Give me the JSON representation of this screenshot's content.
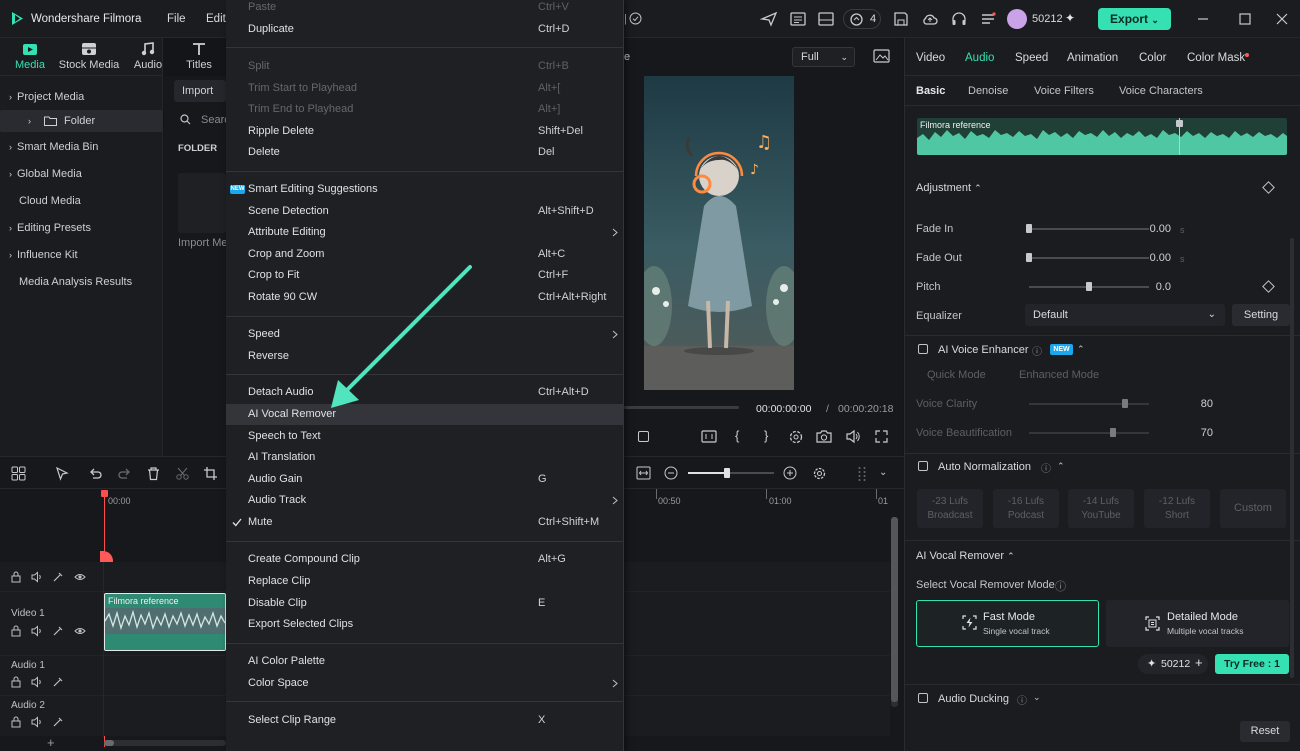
{
  "app": {
    "title": "Wondershare Filmora",
    "menu": [
      "File",
      "Edit"
    ],
    "credits": "50212",
    "undo_count": "4",
    "export_label": "Export"
  },
  "media_tabs": [
    "Media",
    "Stock Media",
    "Audio",
    "Titles"
  ],
  "left_tree": {
    "project_media": "Project Media",
    "folder": "Folder",
    "items": [
      "Smart Media Bin",
      "Global Media",
      "Cloud Media",
      "Editing Presets",
      "Influence Kit",
      "Media Analysis Results"
    ]
  },
  "media_area": {
    "import_label": "Import",
    "search_placeholder": "Search",
    "folder_header": "FOLDER",
    "import_media": "Import Media"
  },
  "context_menu": [
    {
      "label": "Paste",
      "shortcut": "Ctrl+V",
      "disabled": true
    },
    {
      "label": "Duplicate",
      "shortcut": "Ctrl+D"
    },
    {
      "label": "Split",
      "shortcut": "Ctrl+B",
      "disabled": true
    },
    {
      "label": "Trim Start to Playhead",
      "shortcut": "Alt+[",
      "disabled": true
    },
    {
      "label": "Trim End to Playhead",
      "shortcut": "Alt+]",
      "disabled": true
    },
    {
      "label": "Ripple Delete",
      "shortcut": "Shift+Del"
    },
    {
      "label": "Delete",
      "shortcut": "Del"
    },
    {
      "label": "Smart Editing Suggestions",
      "badge": "NEW"
    },
    {
      "label": "Scene Detection",
      "shortcut": "Alt+Shift+D"
    },
    {
      "label": "Attribute Editing",
      "submenu": true
    },
    {
      "label": "Crop and Zoom",
      "shortcut": "Alt+C"
    },
    {
      "label": "Crop to Fit",
      "shortcut": "Ctrl+F"
    },
    {
      "label": "Rotate 90 CW",
      "shortcut": "Ctrl+Alt+Right"
    },
    {
      "label": "Speed",
      "submenu": true
    },
    {
      "label": "Reverse"
    },
    {
      "label": "Detach Audio",
      "shortcut": "Ctrl+Alt+D"
    },
    {
      "label": "AI Vocal Remover",
      "highlighted": true
    },
    {
      "label": "Speech to Text"
    },
    {
      "label": "AI Translation"
    },
    {
      "label": "Audio Gain",
      "shortcut": "G"
    },
    {
      "label": "Audio Track",
      "submenu": true
    },
    {
      "label": "Mute",
      "shortcut": "Ctrl+Shift+M",
      "checked": true
    },
    {
      "label": "Create Compound Clip",
      "shortcut": "Alt+G"
    },
    {
      "label": "Replace Clip"
    },
    {
      "label": "Disable Clip",
      "shortcut": "E"
    },
    {
      "label": "Export Selected Clips"
    },
    {
      "label": "AI Color Palette"
    },
    {
      "label": "Color Space",
      "submenu": true
    },
    {
      "label": "Select Clip Range",
      "shortcut": "X"
    }
  ],
  "preview": {
    "title_fragment": "e",
    "quality": "Full",
    "current_time": "00:00:00:00",
    "separator": "/",
    "total_time": "00:00:20:18"
  },
  "timeline": {
    "ruler": [
      "00:00",
      "00:50",
      "01:00",
      "01"
    ],
    "tracks": [
      "Video 1",
      "Audio 1",
      "Audio 2"
    ],
    "clip_name": "Filmora reference",
    "zoom_percent": 45
  },
  "right_panel": {
    "tabs": [
      "Video",
      "Audio",
      "Speed",
      "Animation",
      "Color",
      "Color Mask"
    ],
    "active_tab": "Audio",
    "sub_tabs": [
      "Basic",
      "Denoise",
      "Voice Filters",
      "Voice Characters"
    ],
    "waveform_label": "Filmora reference",
    "adjustment": "Adjustment",
    "fade_in": {
      "label": "Fade In",
      "value": "0.00",
      "unit": "s",
      "level": 0
    },
    "fade_out": {
      "label": "Fade Out",
      "value": "0.00",
      "unit": "s",
      "level": 0
    },
    "pitch": {
      "label": "Pitch",
      "value": "0.0",
      "level": 0.5
    },
    "equalizer": {
      "label": "Equalizer",
      "value": "Default",
      "setting": "Setting"
    },
    "ai_voice_enhancer": {
      "label": "AI Voice Enhancer",
      "badge": "NEW",
      "modes": [
        "Quick Mode",
        "Enhanced Mode"
      ],
      "voice_clarity": {
        "label": "Voice Clarity",
        "value": "80",
        "level": 0.8
      },
      "voice_beautification": {
        "label": "Voice Beautification",
        "value": "70",
        "level": 0.7
      }
    },
    "auto_normalization": {
      "label": "Auto Normalization",
      "presets": [
        {
          "lufs": "-23 Lufs",
          "name": "Broadcast"
        },
        {
          "lufs": "-16 Lufs",
          "name": "Podcast"
        },
        {
          "lufs": "-14 Lufs",
          "name": "YouTube"
        },
        {
          "lufs": "-12 Lufs",
          "name": "Short"
        },
        {
          "lufs": "Custom",
          "name": ""
        }
      ]
    },
    "ai_vocal_remover": {
      "label": "AI Vocal Remover",
      "select_mode": "Select Vocal Remover Mode",
      "fast_mode": {
        "title": "Fast Mode",
        "sub": "Single vocal track"
      },
      "detailed_mode": {
        "title": "Detailed Mode",
        "sub": "Multiple vocal tracks"
      },
      "credits": "50212",
      "try_free": "Try Free : 1"
    },
    "audio_ducking": "Audio Ducking",
    "reset": "Reset"
  },
  "colors": {
    "accent": "#35e0b3",
    "arrow": "#52e3bf",
    "background": "#141518",
    "clip": "#2f8a74"
  }
}
